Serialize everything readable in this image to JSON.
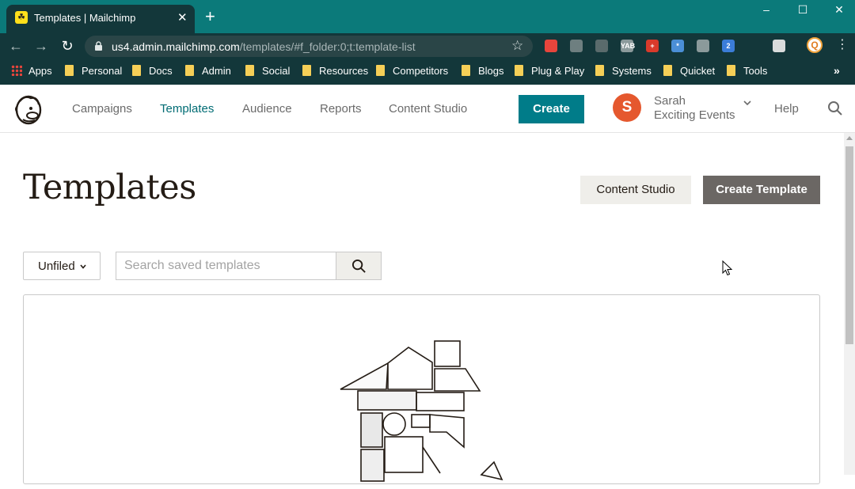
{
  "browser": {
    "tab_title": "Templates | Mailchimp",
    "tab_favicon": "mailchimp-favicon",
    "url_domain": "us4.admin.mailchimp.com",
    "url_path": "/templates/#f_folder:0;t:template-list",
    "profile_initial": "Q",
    "extensions": [
      {
        "name": "pinwheel-extension",
        "color": "#e8453c",
        "label": ""
      },
      {
        "name": "cloud-extension",
        "color": "#6e7f80",
        "label": ""
      },
      {
        "name": "speed-extension",
        "color": "#5a6b6c",
        "label": ""
      },
      {
        "name": "yab-extension",
        "color": "#8b9a9b",
        "label": "YAB"
      },
      {
        "name": "cross-extension",
        "color": "#d93a2b",
        "label": "+"
      },
      {
        "name": "snowflake-extension",
        "color": "#4b8fd6",
        "label": "*"
      },
      {
        "name": "drive-extension",
        "color": "#8b9a9b",
        "label": ""
      },
      {
        "name": "code-extension",
        "color": "#3b7dd8",
        "label": "2"
      },
      {
        "name": "arrow-extension",
        "color": "#13373a",
        "label": ""
      },
      {
        "name": "print-extension",
        "color": "#d9dcdc",
        "label": ""
      }
    ],
    "bookmarks": [
      {
        "label": "Apps",
        "icon": "apps-grid-icon"
      },
      {
        "label": "Personal",
        "icon": "folder-icon"
      },
      {
        "label": "Docs",
        "icon": "folder-icon"
      },
      {
        "label": "Admin",
        "icon": "folder-icon"
      },
      {
        "label": "Social",
        "icon": "folder-icon"
      },
      {
        "label": "Resources",
        "icon": "folder-icon"
      },
      {
        "label": "Competitors",
        "icon": "folder-icon"
      },
      {
        "label": "Blogs",
        "icon": "folder-icon"
      },
      {
        "label": "Plug & Play",
        "icon": "folder-icon"
      },
      {
        "label": "Systems",
        "icon": "folder-icon"
      },
      {
        "label": "Quicket",
        "icon": "folder-icon"
      },
      {
        "label": "Tools",
        "icon": "folder-icon"
      }
    ],
    "bookmarks_overflow": "»"
  },
  "header": {
    "nav": [
      {
        "label": "Campaigns",
        "active": false
      },
      {
        "label": "Templates",
        "active": true
      },
      {
        "label": "Audience",
        "active": false
      },
      {
        "label": "Reports",
        "active": false
      },
      {
        "label": "Content Studio",
        "active": false
      }
    ],
    "create_label": "Create",
    "account": {
      "initial": "S",
      "name": "Sarah",
      "org": "Exciting Events"
    },
    "help_label": "Help"
  },
  "page": {
    "title": "Templates",
    "content_studio_label": "Content Studio",
    "create_template_label": "Create Template",
    "folder_select_value": "Unfiled",
    "search_placeholder": "Search saved templates"
  },
  "colors": {
    "chrome_teal": "#0b7a7a",
    "chrome_dark": "#13373a",
    "brand_teal": "#007c89",
    "avatar_orange": "#e5582e",
    "primary_button": "#6b6764"
  }
}
